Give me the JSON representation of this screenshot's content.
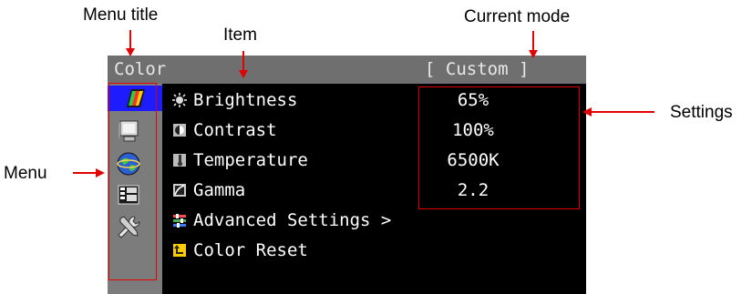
{
  "annotations": {
    "menu_title": "Menu title",
    "item": "Item",
    "current_mode": "Current mode",
    "settings": "Settings",
    "menu": "Menu"
  },
  "osd": {
    "title": "Color",
    "mode": "[  Custom  ]",
    "sidebar": [
      {
        "icon": "color-palette-icon",
        "selected": true
      },
      {
        "icon": "monitor-icon",
        "selected": false
      },
      {
        "icon": "globe-icon",
        "selected": false
      },
      {
        "icon": "info-panel-icon",
        "selected": false
      },
      {
        "icon": "tools-icon",
        "selected": false
      }
    ],
    "items": [
      {
        "label": "Brightness",
        "icon": "brightness-icon",
        "value": "65%"
      },
      {
        "label": "Contrast",
        "icon": "contrast-icon",
        "value": "100%"
      },
      {
        "label": "Temperature",
        "icon": "temperature-icon",
        "value": "6500K"
      },
      {
        "label": "Gamma",
        "icon": "gamma-icon",
        "value": "2.2"
      },
      {
        "label": "Advanced Settings >",
        "icon": "advanced-settings-icon"
      },
      {
        "label": "Color Reset",
        "icon": "color-reset-icon"
      }
    ]
  },
  "colors": {
    "accent": "#e10000",
    "selection": "#1c1cff",
    "title_bar": "#6f6f6f",
    "sidebar": "#7c7c7c"
  }
}
